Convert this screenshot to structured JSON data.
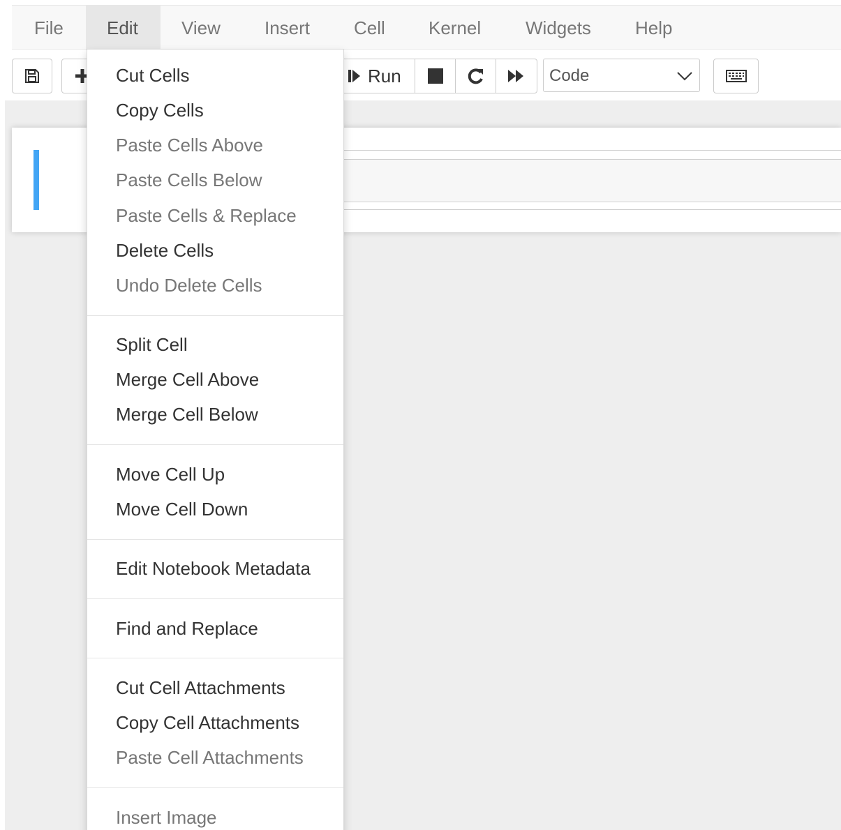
{
  "menubar": {
    "items": [
      {
        "label": "File"
      },
      {
        "label": "Edit",
        "open": true
      },
      {
        "label": "View"
      },
      {
        "label": "Insert"
      },
      {
        "label": "Cell"
      },
      {
        "label": "Kernel"
      },
      {
        "label": "Widgets"
      },
      {
        "label": "Help"
      }
    ]
  },
  "toolbar": {
    "save_icon": "floppy-disk-icon",
    "add_icon": "plus-icon",
    "run_label": "Run",
    "run_icon": "step-forward-icon",
    "interrupt_icon": "stop-square-icon",
    "restart_icon": "redo-icon",
    "restart_run_all_icon": "fast-forward-icon",
    "cell_type": {
      "value": "Code",
      "options_visible": [
        "Code"
      ]
    },
    "command_palette_icon": "keyboard-icon"
  },
  "edit_menu": {
    "groups": [
      {
        "items": [
          {
            "label": "Cut Cells",
            "enabled": true
          },
          {
            "label": "Copy Cells",
            "enabled": true
          },
          {
            "label": "Paste Cells Above",
            "enabled": false
          },
          {
            "label": "Paste Cells Below",
            "enabled": false
          },
          {
            "label": "Paste Cells & Replace",
            "enabled": false
          },
          {
            "label": "Delete Cells",
            "enabled": true
          },
          {
            "label": "Undo Delete Cells",
            "enabled": false
          }
        ]
      },
      {
        "items": [
          {
            "label": "Split Cell",
            "enabled": true
          },
          {
            "label": "Merge Cell Above",
            "enabled": true
          },
          {
            "label": "Merge Cell Below",
            "enabled": true
          }
        ]
      },
      {
        "items": [
          {
            "label": "Move Cell Up",
            "enabled": true
          },
          {
            "label": "Move Cell Down",
            "enabled": true
          }
        ]
      },
      {
        "items": [
          {
            "label": "Edit Notebook Metadata",
            "enabled": true
          }
        ]
      },
      {
        "items": [
          {
            "label": "Find and Replace",
            "enabled": true
          }
        ]
      },
      {
        "items": [
          {
            "label": "Cut Cell Attachments",
            "enabled": true
          },
          {
            "label": "Copy Cell Attachments",
            "enabled": true
          },
          {
            "label": "Paste Cell Attachments",
            "enabled": false
          }
        ]
      },
      {
        "items": [
          {
            "label": "Insert Image",
            "enabled": false
          }
        ]
      }
    ]
  },
  "colors": {
    "selected_cell_bar": "#42a5f5",
    "notebook_background": "#eeeeee",
    "menubar_background": "#f8f8f8",
    "enabled_text": "#333333",
    "disabled_text": "#777777"
  }
}
